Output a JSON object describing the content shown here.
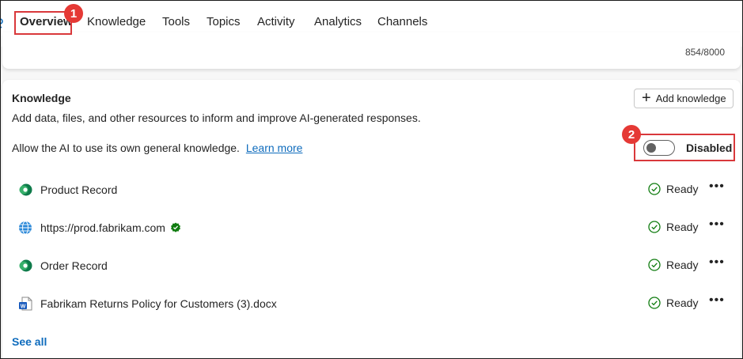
{
  "tabs": [
    {
      "label": "Overview",
      "active": true
    },
    {
      "label": "Knowledge"
    },
    {
      "label": "Tools"
    },
    {
      "label": "Topics"
    },
    {
      "label": "Activity"
    },
    {
      "label": "Analytics"
    },
    {
      "label": "Channels"
    }
  ],
  "upper_card": {
    "char_count": "854/8000"
  },
  "knowledge": {
    "title": "Knowledge",
    "description": "Add data, files, and other resources to inform and improve AI-generated responses.",
    "add_button_label": "Add knowledge",
    "general_knowledge_text": "Allow the AI to use its own general knowledge.",
    "learn_more_label": "Learn more",
    "toggle": {
      "state": "off",
      "label": "Disabled"
    },
    "items": [
      {
        "name": "Product Record",
        "icon": "dataverse-icon",
        "status": "Ready"
      },
      {
        "name": "https://prod.fabrikam.com",
        "icon": "globe-icon",
        "verified": true,
        "status": "Ready"
      },
      {
        "name": "Order Record",
        "icon": "dataverse-icon",
        "status": "Ready"
      },
      {
        "name": "Fabrikam Returns Policy for Customers (3).docx",
        "icon": "word-doc-icon",
        "status": "Ready"
      }
    ],
    "see_all_label": "See all"
  },
  "annotations": [
    {
      "number": "1",
      "color": "#e53935"
    },
    {
      "number": "2",
      "color": "#e53935"
    }
  ],
  "colors": {
    "accent": "#0f6cbd",
    "ready_green": "#107c10",
    "callout_red": "#d9383b"
  }
}
